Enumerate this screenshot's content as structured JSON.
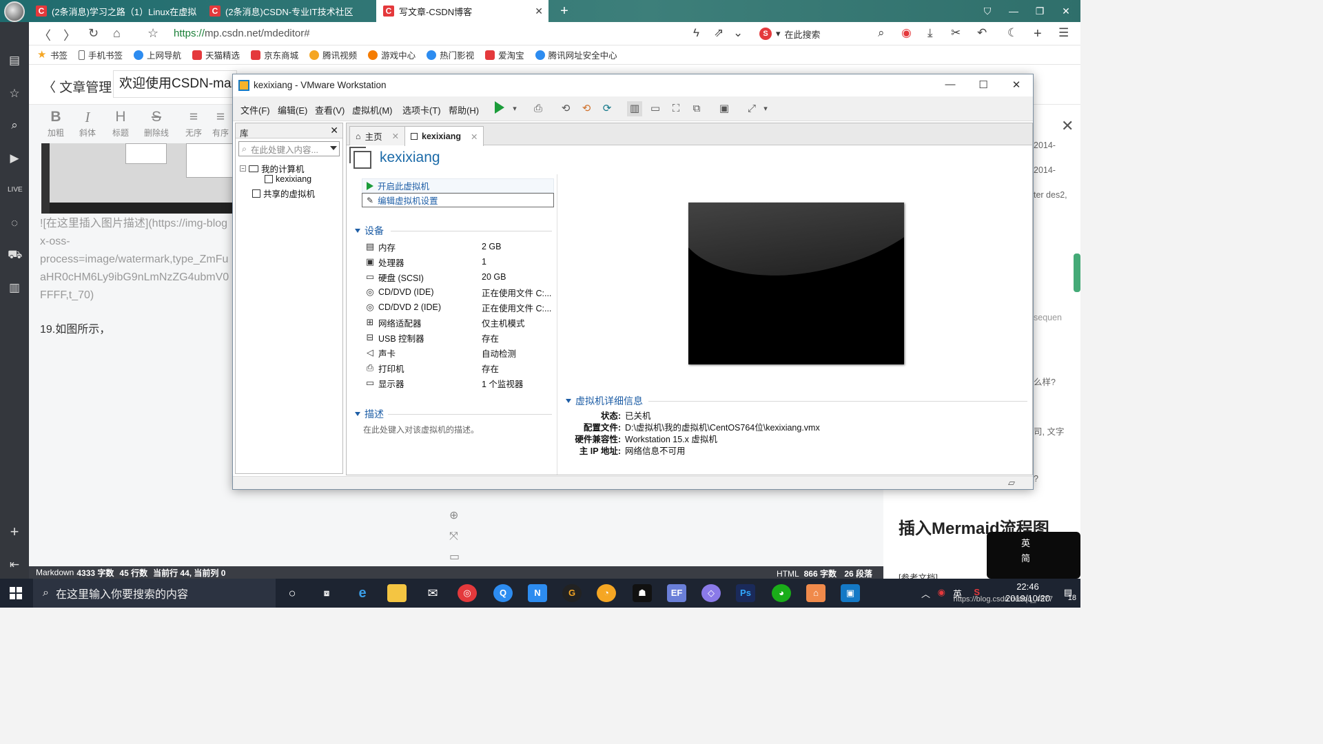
{
  "browser": {
    "tabs": [
      {
        "label": "(2条消息)学习之路（1）Linux在虚拟",
        "active": false
      },
      {
        "label": "(2条消息)CSDN-专业IT技术社区",
        "active": false
      },
      {
        "label": "写文章-CSDN博客",
        "active": true
      }
    ],
    "url_prefix": "https://",
    "url_rest": "mp.csdn.net/mdeditor#",
    "search_placeholder": "在此搜索",
    "bookmarks": [
      {
        "label": "书签",
        "color": "#f5a623"
      },
      {
        "label": "手机书签",
        "color": "#888888"
      },
      {
        "label": "上网导航",
        "color": "#2d8cf0"
      },
      {
        "label": "天猫精选",
        "color": "#e4393c"
      },
      {
        "label": "京东商城",
        "color": "#e4393c"
      },
      {
        "label": "腾讯视频",
        "color": "#f5a623"
      },
      {
        "label": "游戏中心",
        "color": "#f57c00"
      },
      {
        "label": "热门影视",
        "color": "#2d8cf0"
      },
      {
        "label": "爱淘宝",
        "color": "#e4393c"
      },
      {
        "label": "腾讯网址安全中心",
        "color": "#2d8cf0"
      }
    ]
  },
  "editor": {
    "back_label": "文章管理",
    "title_value": "欢迎使用CSDN-mar",
    "toolbar": [
      {
        "glyph": "B",
        "label": "加粗"
      },
      {
        "glyph": "I",
        "label": "斜体"
      },
      {
        "glyph": "H",
        "label": "标题"
      },
      {
        "glyph": "S",
        "label": "删除线"
      },
      {
        "glyph": "≡",
        "label": "无序"
      },
      {
        "glyph": "≡",
        "label": "有序"
      }
    ],
    "md_line1": "![在这里插入图片描述](https://img-blog",
    "md_line2": "x-oss-",
    "md_line3": "process=image/watermark,type_ZmFu",
    "md_line4": "aHR0cHM6Ly9ibG9nLmNzZG4ubmV0",
    "md_line5": "FFFF,t_70)",
    "step_text": "19.如图所示，",
    "status_left_mode": "Markdown",
    "status_chars": "4333 字数",
    "status_lines": "45 行数",
    "status_cursor": "当前行 44, 当前列 0",
    "status_right_mode": "HTML",
    "status_right_chars": "866 字数",
    "status_right_paras": "26 段落"
  },
  "preview": {
    "frag1": "2014-",
    "frag2": "2014-",
    "frag3": "ter des2,",
    "frag4": "sequen",
    "frag5": "么样?",
    "frag6": "司, 文字",
    "frag7": "?",
    "heading": "插入Mermaid流程图",
    "ref": "[参考文档]"
  },
  "vmware": {
    "title": "kexixiang - VMware Workstation",
    "menu": [
      "文件(F)",
      "编辑(E)",
      "查看(V)",
      "虚拟机(M)",
      "选项卡(T)",
      "帮助(H)"
    ],
    "library_title": "库",
    "library_search": "在此处键入内容...",
    "tree": {
      "my_computer": "我的计算机",
      "vm": "kexixiang",
      "shared": "共享的虚拟机"
    },
    "tabs": [
      {
        "label": "主页",
        "active": false
      },
      {
        "label": "kexixiang",
        "active": true
      }
    ],
    "vm_name": "kexixiang",
    "actions": {
      "power_on": "开启此虚拟机",
      "edit": "编辑虚拟机设置"
    },
    "devices_title": "设备",
    "devices": [
      {
        "name": "内存",
        "value": "2 GB",
        "icon": "memory-icon"
      },
      {
        "name": "处理器",
        "value": "1",
        "icon": "cpu-icon"
      },
      {
        "name": "硬盘 (SCSI)",
        "value": "20 GB",
        "icon": "disk-icon"
      },
      {
        "name": "CD/DVD (IDE)",
        "value": "正在使用文件 C:...",
        "icon": "cd-icon"
      },
      {
        "name": "CD/DVD 2 (IDE)",
        "value": "正在使用文件 C:...",
        "icon": "cd-icon"
      },
      {
        "name": "网络适配器",
        "value": "仅主机模式",
        "icon": "network-icon"
      },
      {
        "name": "USB 控制器",
        "value": "存在",
        "icon": "usb-icon"
      },
      {
        "name": "声卡",
        "value": "自动检测",
        "icon": "sound-icon"
      },
      {
        "name": "打印机",
        "value": "存在",
        "icon": "printer-icon"
      },
      {
        "name": "显示器",
        "value": "1 个监视器",
        "icon": "display-icon"
      }
    ],
    "description_title": "描述",
    "description_placeholder": "在此处键入对该虚拟机的描述。",
    "details_title": "虚拟机详细信息",
    "details": [
      {
        "key": "状态:",
        "value": "已关机"
      },
      {
        "key": "配置文件:",
        "value": "D:\\虚拟机\\我的虚拟机\\CentOS764位\\kexixiang.vmx"
      },
      {
        "key": "硬件兼容性:",
        "value": "Workstation 15.x 虚拟机"
      },
      {
        "key": "主 IP 地址:",
        "value": "网络信息不可用"
      }
    ]
  },
  "taskbar": {
    "search_placeholder": "在这里输入你要搜索的内容",
    "ime": "英",
    "time": "22:46",
    "date": "2019/10/20",
    "notif_count": "18",
    "watermark": "https://blog.csdn.net/qq_4577",
    "ime_float_line1": "英",
    "ime_float_line2": "简"
  }
}
